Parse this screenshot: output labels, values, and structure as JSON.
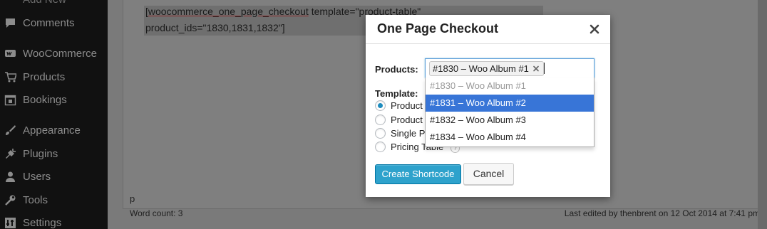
{
  "sidebar": {
    "items": [
      {
        "label": "Add New",
        "icon": "add-new-icon"
      },
      {
        "label": "Comments",
        "icon": "comments-icon"
      },
      {
        "label": "WooCommerce",
        "icon": "woocommerce-icon"
      },
      {
        "label": "Products",
        "icon": "products-icon"
      },
      {
        "label": "Bookings",
        "icon": "bookings-icon"
      },
      {
        "label": "Appearance",
        "icon": "appearance-icon"
      },
      {
        "label": "Plugins",
        "icon": "plugins-icon"
      },
      {
        "label": "Users",
        "icon": "users-icon"
      },
      {
        "label": "Tools",
        "icon": "tools-icon"
      },
      {
        "label": "Settings",
        "icon": "settings-icon"
      }
    ]
  },
  "editor": {
    "shortcode_line1_tag": "woocommerce_one_page_checkout",
    "shortcode_line1_open": "[",
    "shortcode_line1_rest": " template=\"product-table\"",
    "shortcode_line2": "product_ids=\"1830,1831,1832\"]",
    "path": "p",
    "word_count": "Word count: 3",
    "last_edited": "Last edited by thenbrent on 12 Oct 2014 at 7:41 pm"
  },
  "modal": {
    "title": "One Page Checkout",
    "close_icon": "close-icon",
    "products_label": "Products:",
    "selected_token": "#1830 – Woo Album #1",
    "template_label": "Template:",
    "templates": [
      {
        "label": "Product Table",
        "checked": true
      },
      {
        "label": "Product List",
        "checked": false
      },
      {
        "label": "Single Product",
        "checked": false
      },
      {
        "label": "Pricing Table",
        "checked": false
      }
    ],
    "help_icon": "?",
    "create_button": "Create Shortcode",
    "cancel_button": "Cancel"
  },
  "dropdown": {
    "options": [
      {
        "label": "#1830 – Woo Album #1",
        "state": "disabled"
      },
      {
        "label": "#1831 – Woo Album #2",
        "state": "highlighted"
      },
      {
        "label": "#1832 – Woo Album #3",
        "state": "normal"
      },
      {
        "label": "#1834 – Woo Album #4",
        "state": "normal"
      }
    ]
  },
  "colors": {
    "primary_button": "#2ea2cc",
    "highlight": "#3875d7",
    "sidebar_bg": "#111111"
  }
}
